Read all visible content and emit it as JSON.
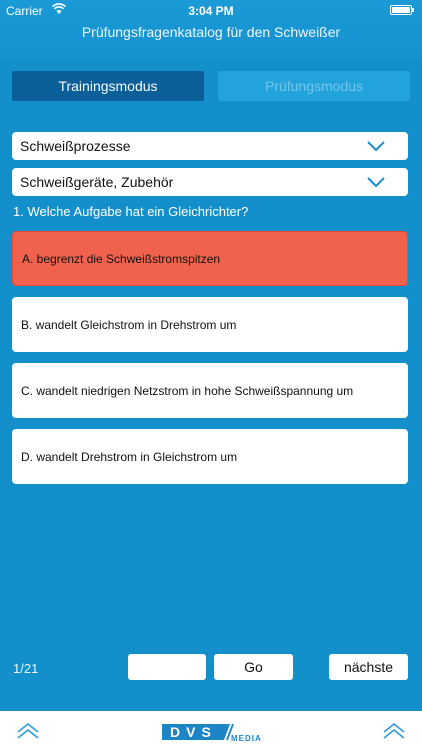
{
  "status_bar": {
    "carrier": "Carrier",
    "time": "3:04 PM"
  },
  "header": {
    "title": "Prüfungsfragenkatalog für den Schweißer"
  },
  "modes": {
    "training": "Trainingsmodus",
    "pruefung": "Prüfungsmodus"
  },
  "filters": {
    "category": "Schweißprozesse",
    "subcategory": "Schweißgeräte, Zubehör"
  },
  "question": {
    "text": "1. Welche Aufgabe hat ein Gleichrichter?"
  },
  "answers": [
    {
      "label": "A.  begrenzt die Schweißstromspitzen",
      "state": "wrong"
    },
    {
      "label": "B.  wandelt Gleichstrom in Drehstrom um"
    },
    {
      "label": "C.  wandelt niedrigen Netzstrom in hohe Schweißspannung um"
    },
    {
      "label": "D.  wandelt Drehstrom in Gleichstrom um"
    }
  ],
  "navigation": {
    "counter": "1/21",
    "goto_value": "",
    "go_label": "Go",
    "next_label": "nächste"
  },
  "footer": {
    "logo_text": "DVS",
    "logo_sub": "MEDIA"
  },
  "colors": {
    "background": "#1390cb",
    "active_tab": "#0b5f98",
    "wrong_answer": "#f0624d",
    "logo_blue": "#1d84c6"
  },
  "icons": [
    "wifi-icon",
    "battery-icon",
    "chevron-down-icon",
    "chevron-up-icon"
  ]
}
